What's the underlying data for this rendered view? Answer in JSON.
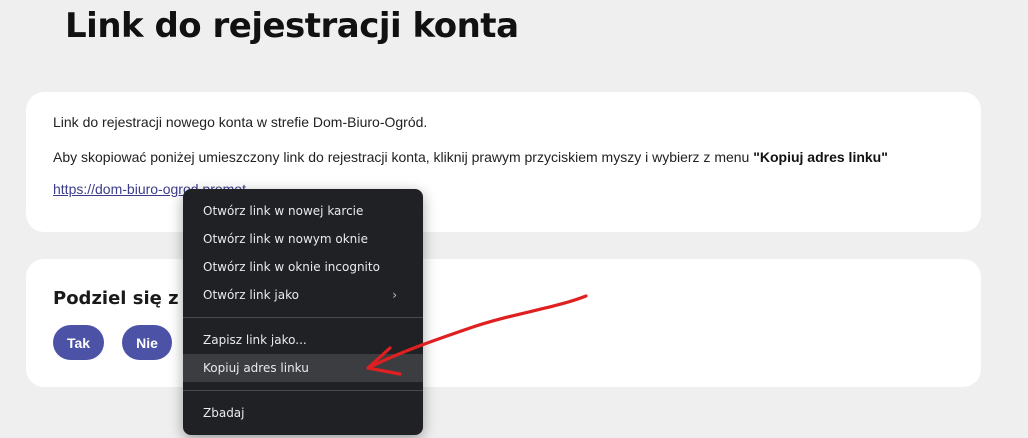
{
  "page": {
    "title": "Link do rejestracji konta"
  },
  "info_card": {
    "line1": "Link do rejestracji nowego konta w strefie Dom-Biuro-Ogród.",
    "line2_prefix": "Aby skopiować poniżej umieszczony link do rejestracji konta, kliknij prawym przyciskiem myszy i wybierz z menu ",
    "line2_bold": "\"Kopiuj adres linku\"",
    "link_text": "https://dom-biuro-ogrod.promot..."
  },
  "share_card": {
    "title": "Podziel się z",
    "yes_label": "Tak",
    "no_label": "Nie"
  },
  "context_menu": {
    "items": [
      {
        "label": "Otwórz link w nowej karcie"
      },
      {
        "label": "Otwórz link w nowym oknie"
      },
      {
        "label": "Otwórz link w oknie incognito"
      },
      {
        "label": "Otwórz link jako",
        "submenu_arrow": "›"
      },
      {
        "label": "Zapisz link jako..."
      },
      {
        "label": "Kopiuj adres linku",
        "highlighted": true
      },
      {
        "label": "Zbadaj"
      }
    ]
  },
  "colors": {
    "page_bg": "#efefef",
    "card_bg": "#ffffff",
    "pill_bg": "#4c52a6",
    "menu_bg": "#202124",
    "menu_highlight": "#3c3d40",
    "annotation_arrow": "#e02020"
  }
}
